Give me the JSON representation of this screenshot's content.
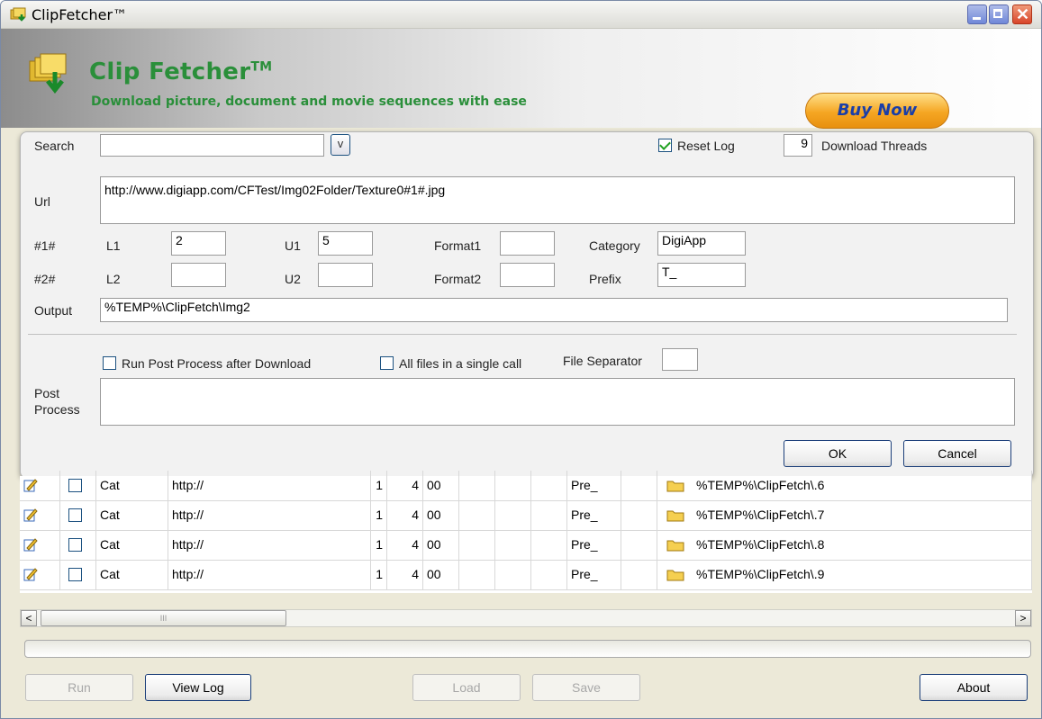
{
  "window": {
    "title": "ClipFetcher™"
  },
  "banner": {
    "title": "Clip Fetcher",
    "title_tm": "TM",
    "subtitle": "Download picture, document and movie sequences with ease",
    "buy_now": "Buy Now"
  },
  "form": {
    "search_label": "Search",
    "search_value": "",
    "dropdown_label": "v",
    "reset_log_label": "Reset Log",
    "reset_log_checked": true,
    "threads_value": "9",
    "threads_label": "Download Threads",
    "url_label": "Url",
    "url_value": "http://www.digiapp.com/CFTest/Img02Folder/Texture0#1#.jpg",
    "row1_label": "#1#",
    "l1_label": "L1",
    "l1_value": "2",
    "u1_label": "U1",
    "u1_value": "5",
    "format1_label": "Format1",
    "format1_value": "",
    "category_label": "Category",
    "category_value": "DigiApp",
    "row2_label": "#2#",
    "l2_label": "L2",
    "l2_value": "",
    "u2_label": "U2",
    "u2_value": "",
    "format2_label": "Format2",
    "format2_value": "",
    "prefix_label": "Prefix",
    "prefix_value": "T_",
    "output_label": "Output",
    "output_value": "%TEMP%\\ClipFetch\\Img2",
    "run_post_label": "Run Post Process after Download",
    "all_files_label": "All files in a single call",
    "file_sep_label": "File Separator",
    "file_sep_value": "",
    "post_label_1": "Post",
    "post_label_2": "Process",
    "post_value": "",
    "ok": "OK",
    "cancel": "Cancel"
  },
  "grid": {
    "rows": [
      {
        "category": "Cat",
        "url": "http://",
        "c1": "1",
        "c2": "4",
        "c3": "00",
        "prefix": "Pre_",
        "output": "%TEMP%\\ClipFetch\\.6"
      },
      {
        "category": "Cat",
        "url": "http://",
        "c1": "1",
        "c2": "4",
        "c3": "00",
        "prefix": "Pre_",
        "output": "%TEMP%\\ClipFetch\\.7"
      },
      {
        "category": "Cat",
        "url": "http://",
        "c1": "1",
        "c2": "4",
        "c3": "00",
        "prefix": "Pre_",
        "output": "%TEMP%\\ClipFetch\\.8"
      },
      {
        "category": "Cat",
        "url": "http://",
        "c1": "1",
        "c2": "4",
        "c3": "00",
        "prefix": "Pre_",
        "output": "%TEMP%\\ClipFetch\\.9"
      }
    ]
  },
  "scrollbar": {
    "left_arrow": "<",
    "right_arrow": ">",
    "thumb_grip": "III"
  },
  "bottom": {
    "run": "Run",
    "view_log": "View Log",
    "load": "Load",
    "save": "Save",
    "about": "About"
  },
  "colors": {
    "accent_green": "#2a8f3a",
    "buy_orange": "#f5a623",
    "buy_text": "#1a3ea8"
  }
}
